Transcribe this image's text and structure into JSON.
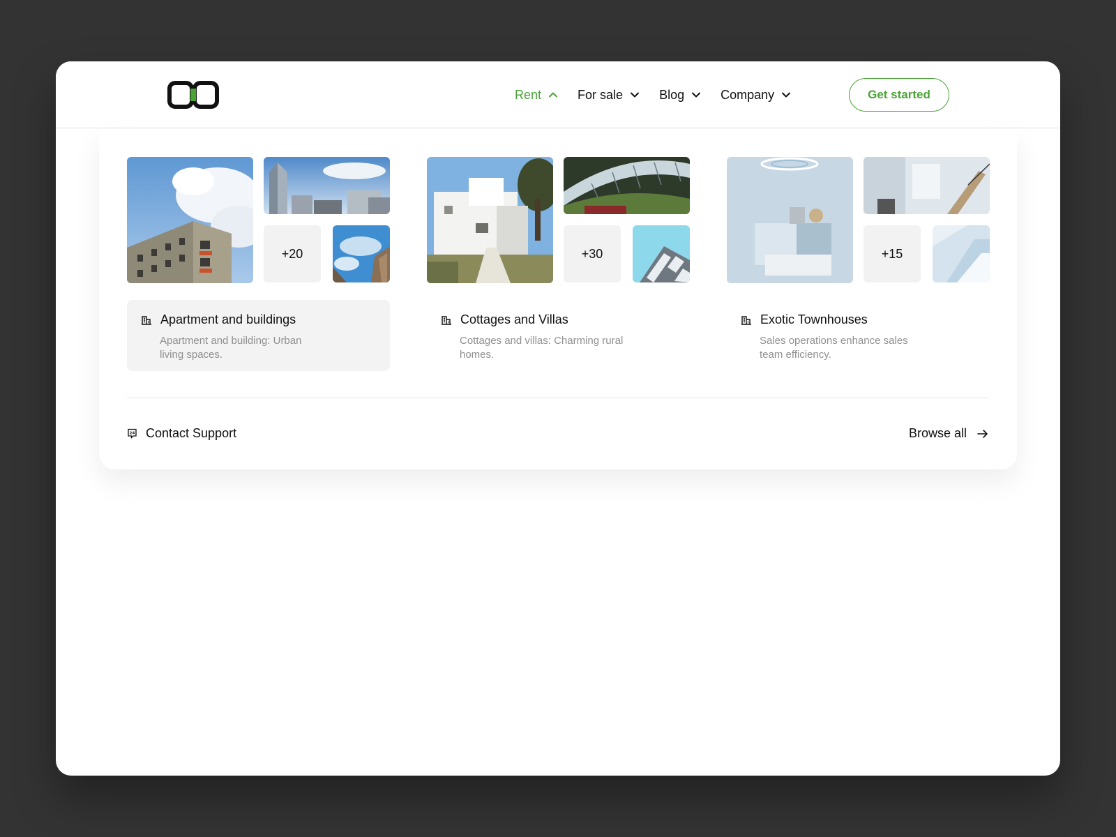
{
  "header": {
    "logo": "brand-logo",
    "nav": [
      {
        "label": "Rent",
        "icon": "chevron-up-icon",
        "active": true
      },
      {
        "label": "For sale",
        "icon": "chevron-down-icon"
      },
      {
        "label": "Blog",
        "icon": "chevron-down-icon"
      },
      {
        "label": "Company",
        "icon": "chevron-down-icon"
      }
    ],
    "cta_label": "Get started"
  },
  "colors": {
    "accent": "#4aa336",
    "background": "#333333",
    "muted_text": "#8f8f8f",
    "card_active": "#f3f3f3"
  },
  "categories": [
    {
      "title": "Apartment and buildings",
      "description": "Apartment and building: Urban living spaces.",
      "count": "+20",
      "icon": "building-icon",
      "active": true
    },
    {
      "title": "Cottages and Villas",
      "description": "Cottages and villas: Charming rural homes.",
      "count": "+30",
      "icon": "building-icon"
    },
    {
      "title": "Exotic Townhouses",
      "description": "Sales operations enhance sales team efficiency.",
      "count": "+15",
      "icon": "building-icon"
    }
  ],
  "footer": {
    "support_label": "Contact Support",
    "support_icon": "support-24-icon",
    "browse_label": "Browse all",
    "browse_icon": "arrow-right-icon"
  }
}
